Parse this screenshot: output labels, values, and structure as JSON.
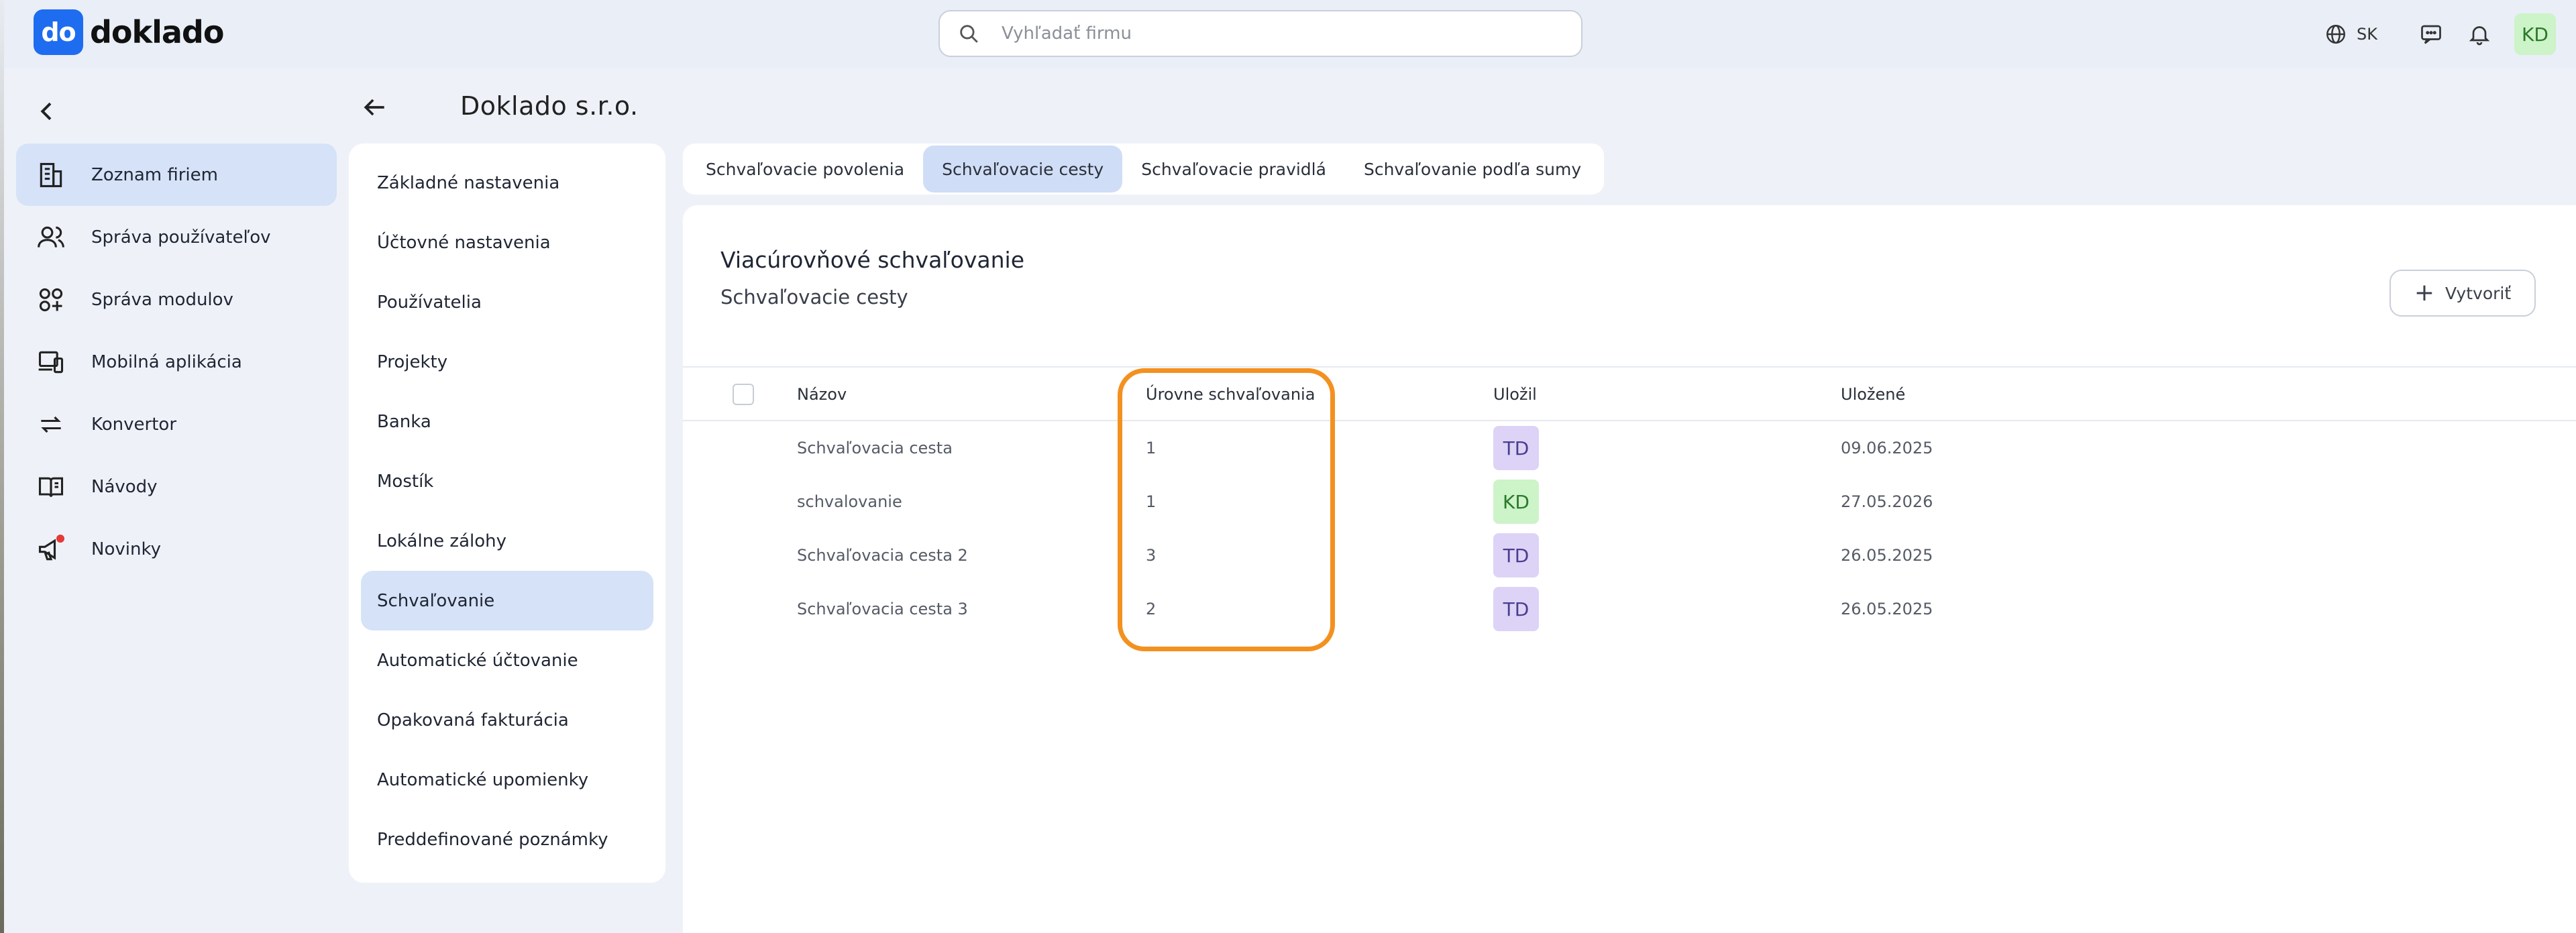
{
  "app": {
    "logo_mark": "do",
    "logo_text": "doklado"
  },
  "search": {
    "placeholder": "Vyhľadať firmu",
    "value": ""
  },
  "topbar": {
    "language": "SK",
    "user_initials": "KD",
    "icons": [
      "globe-icon",
      "chat-icon",
      "bell-icon"
    ]
  },
  "nav": {
    "items": [
      {
        "label": "Zoznam firiem",
        "icon": "building-icon",
        "active": true
      },
      {
        "label": "Správa používateľov",
        "icon": "users-icon",
        "active": false
      },
      {
        "label": "Správa modulov",
        "icon": "modules-icon",
        "active": false
      },
      {
        "label": "Mobilná aplikácia",
        "icon": "devices-icon",
        "active": false
      },
      {
        "label": "Konvertor",
        "icon": "convert-icon",
        "active": false
      },
      {
        "label": "Návody",
        "icon": "book-icon",
        "active": false
      },
      {
        "label": "Novinky",
        "icon": "megaphone-icon",
        "active": false
      }
    ]
  },
  "header": {
    "company": "Doklado s.r.o."
  },
  "settings_menu": {
    "items": [
      "Základné nastavenia",
      "Účtovné nastavenia",
      "Používatelia",
      "Projekty",
      "Banka",
      "Mostík",
      "Lokálne zálohy",
      "Schvaľovanie",
      "Automatické účtovanie",
      "Opakovaná fakturácia",
      "Automatické upomienky",
      "Preddefinované poznámky"
    ],
    "active_index": 7
  },
  "tabs": {
    "items": [
      "Schvaľovacie povolenia",
      "Schvaľovacie cesty",
      "Schvaľovacie pravidlá",
      "Schvaľovanie podľa sumy"
    ],
    "active_index": 1
  },
  "card": {
    "title": "Viacúrovňové schvaľovanie",
    "subtitle": "Schvaľovacie cesty",
    "create_label": "Vytvoriť"
  },
  "table": {
    "columns": {
      "name": "Názov",
      "levels": "Úrovne schvaľovania",
      "saved_by": "Uložil",
      "saved_at": "Uložené"
    },
    "rows": [
      {
        "name": "Schvaľovacia cesta",
        "levels": "1",
        "saved_by": "TD",
        "saved_at": "09.06.2025"
      },
      {
        "name": "schvalovanie",
        "levels": "1",
        "saved_by": "KD",
        "saved_at": "27.05.2026"
      },
      {
        "name": "Schvaľovacia cesta 2",
        "levels": "3",
        "saved_by": "TD",
        "saved_at": "26.05.2025"
      },
      {
        "name": "Schvaľovacia cesta 3",
        "levels": "2",
        "saved_by": "TD",
        "saved_at": "26.05.2025"
      }
    ]
  },
  "colors": {
    "accent": "#1e6cf0",
    "active_bg": "#d5e2f8",
    "highlight": "#f39120",
    "badge_td_bg": "#ddd3f7",
    "badge_td_fg": "#4a3f8c",
    "badge_kd_bg": "#cdf3c8",
    "badge_kd_fg": "#2a7a2a"
  }
}
